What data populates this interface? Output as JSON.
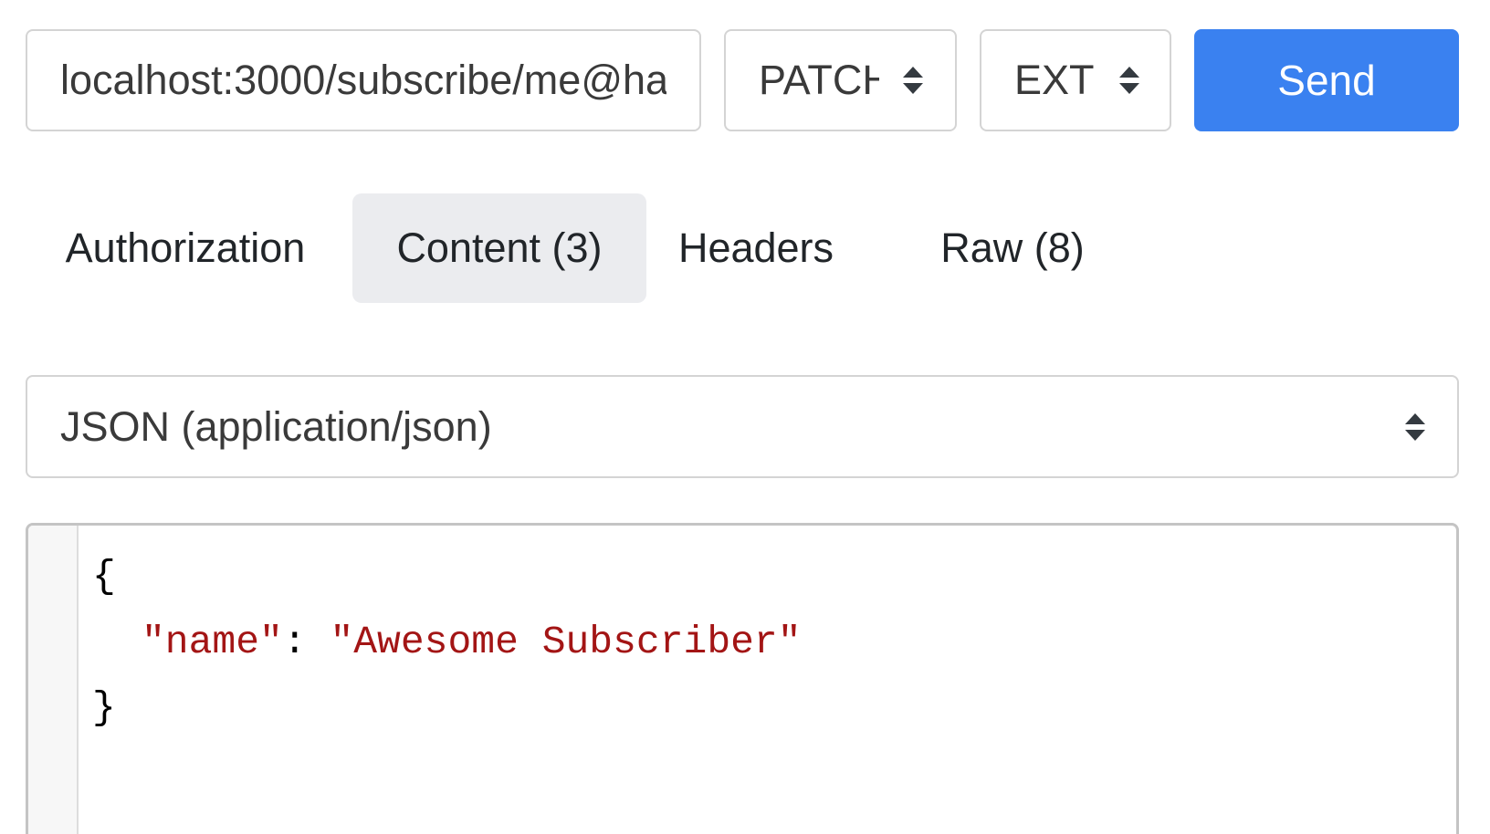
{
  "request": {
    "url": "localhost:3000/subscribe/me@ha",
    "method": "PATCH",
    "extension": "EXT",
    "send_label": "Send"
  },
  "tabs": [
    {
      "label": "Authorization",
      "active": false
    },
    {
      "label": "Content (3)",
      "active": true
    },
    {
      "label": "Headers",
      "active": false
    },
    {
      "label": "Raw (8)",
      "active": false
    }
  ],
  "content_type": {
    "selected": "JSON (application/json)"
  },
  "editor": {
    "open_brace": "{",
    "key": "\"name\"",
    "colon": ":",
    "value": "\"Awesome Subscriber\"",
    "close_brace": "}"
  },
  "colors": {
    "accent": "#3a81f0",
    "active_tab_bg": "#ebecef",
    "string_token": "#a31515"
  },
  "icons": {
    "select_arrow": "sort-icon"
  }
}
